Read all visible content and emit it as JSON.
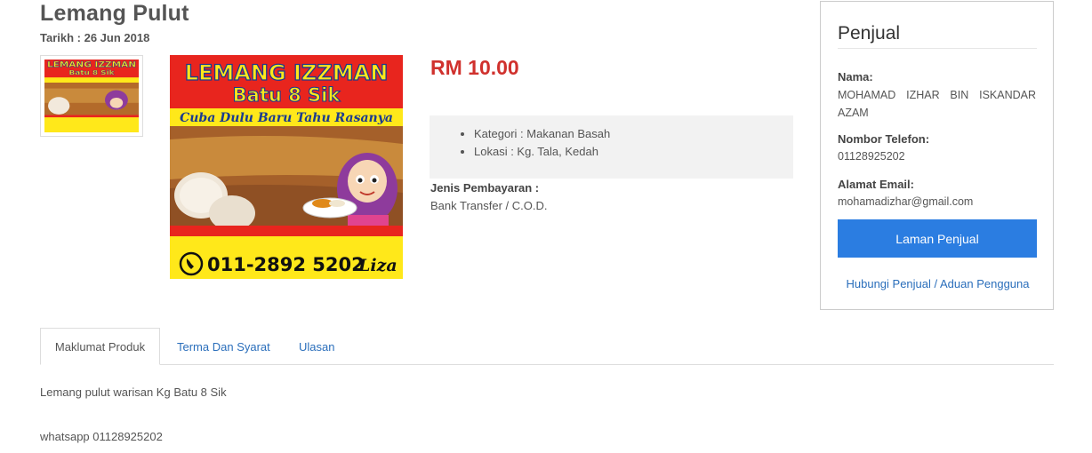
{
  "product": {
    "title": "Lemang Pulut",
    "date": "Tarikh : 26 Jun 2018",
    "price": "RM 10.00",
    "details": [
      "Kategori : Makanan Basah",
      "Lokasi : Kg. Tala, Kedah"
    ],
    "payment_label": "Jenis Pembayaran :",
    "payment_value": "Bank Transfer / C.O.D."
  },
  "banner": {
    "line1": "LEMANG IZZMAN",
    "line2": "Batu 8 Sik",
    "tagline": "Cuba Dulu Baru Tahu Rasanya",
    "phone": "011-2892 5202",
    "name": "Liza",
    "colors": {
      "red": "#e8251e",
      "yellow": "#ffe81a",
      "blue": "#1a3b8f"
    }
  },
  "seller": {
    "heading": "Penjual",
    "name_label": "Nama:",
    "name_value": "MOHAMAD IZHAR BIN ISKANDAR AZAM",
    "phone_label": "Nombor Telefon:",
    "phone_value": "01128925202",
    "email_label": "Alamat Email:",
    "email_value": "mohamadizhar@gmail.com",
    "button_label": "Laman Penjual",
    "contact_link": "Hubungi Penjual",
    "separator": " / ",
    "report_link": "Aduan Pengguna"
  },
  "tabs": [
    {
      "label": "Maklumat Produk"
    },
    {
      "label": "Terma Dan Syarat"
    },
    {
      "label": "Ulasan"
    }
  ],
  "description": {
    "line1": "Lemang pulut warisan Kg Batu 8 Sik",
    "line2": "whatsapp 01128925202"
  },
  "colors": {
    "accent_blue": "#2b7de1",
    "price_red": "#d0312d",
    "link_blue": "#2a6ebb"
  }
}
